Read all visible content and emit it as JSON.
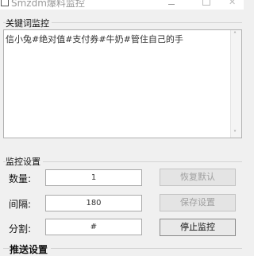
{
  "window": {
    "title": "Smzdm爆料监控"
  },
  "keyword_section": {
    "label": "关键词监控",
    "text": "信小兔#绝对值#支付券#牛奶#管住自己的手"
  },
  "monitor_section": {
    "label": "监控设置",
    "fields": [
      {
        "label": "数量:",
        "value": "1"
      },
      {
        "label": "间隔:",
        "value": "180"
      },
      {
        "label": "分割:",
        "value": "#"
      }
    ],
    "buttons": [
      {
        "label": "恢复默认",
        "enabled": false
      },
      {
        "label": "保存设置",
        "enabled": false
      },
      {
        "label": "停止监控",
        "enabled": true
      }
    ]
  },
  "push_section": {
    "label": "推送设置"
  }
}
